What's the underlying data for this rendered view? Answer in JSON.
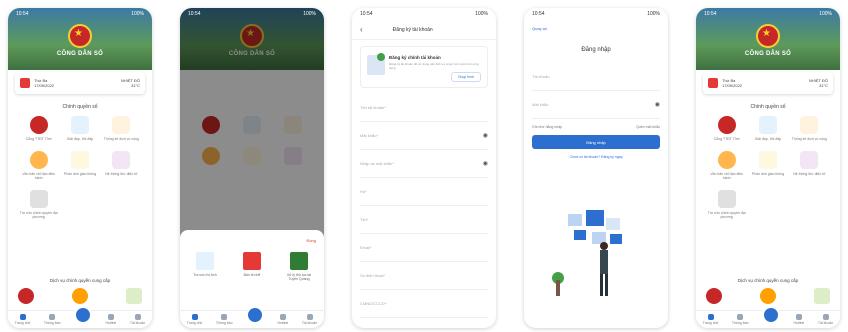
{
  "app_title": "CÔNG DÂN SỐ",
  "status": {
    "time": "10:54",
    "right": "100%"
  },
  "colors": {
    "accent": "#2d6fce",
    "red": "#e53935",
    "green": "#43a047"
  },
  "screen1": {
    "date_left_label": "Thứ Ba",
    "date_left_value": "17/05/2022",
    "date_right_label": "NHIỆT ĐỘ",
    "date_right_value": "31°C",
    "section_title": "Chính quyền số",
    "tiles": [
      {
        "label": "Cổng TTĐT Tỉnh",
        "icon": "emblem-icon",
        "color": "#c62828"
      },
      {
        "label": "Giải đáp, hỏi đáp",
        "icon": "ear-icon",
        "color": "#e3f2fd"
      },
      {
        "label": "Thống kê dịch vụ công",
        "icon": "chart-icon",
        "color": "#fff3e0"
      },
      {
        "label": "Văn bản chỉ đạo điều hành",
        "icon": "emblem-icon",
        "color": "#ffe0b2"
      },
      {
        "label": "Phản ánh giao thông",
        "icon": "hands-icon",
        "color": "#fff8e1"
      },
      {
        "label": "Hệ thống thư điện tử",
        "icon": "mail-icon",
        "color": "#f3e5f5"
      },
      {
        "label": "Tra cứu chính quyền địa phương",
        "icon": "document-icon",
        "color": "#eeeeee"
      }
    ],
    "services_title": "Dịch vụ chính quyền cung cấp",
    "nav": [
      "Trang chủ",
      "Thông báo",
      "",
      "Hotline",
      "Tài khoản"
    ]
  },
  "screen2": {
    "close_label": "Đóng",
    "items": [
      {
        "label": "Tra cứu hộ tịch",
        "color": "#e3f2fd"
      },
      {
        "label": "Bản tin thể",
        "color": "#e53935"
      },
      {
        "label": "Xử lý thủ tục tại Tuyên Quang",
        "color": "#2e7d32"
      }
    ]
  },
  "screen3": {
    "header": "Đăng ký tài khoản",
    "card_title": "Đăng ký chính tài khoản",
    "card_desc": "Đăng ký tài khoản để sử dụng các dịch vụ công trực tuyến trên ứng dụng",
    "card_button": "Chụp hình",
    "fields": [
      "Tên tài khoản*",
      "Mật khẩu*",
      "Nhập lại mật khẩu*",
      "Họ*",
      "Tên*",
      "Email*",
      "Số điện thoại*",
      "CMND/CCCD*"
    ]
  },
  "screen4": {
    "back": "Quay lại",
    "title": "Đăng nhập",
    "username_placeholder": "Tài khoản",
    "password_placeholder": "Mật khẩu",
    "remember": "Ghi nhớ đăng nhập",
    "forgot": "Quên mật khẩu",
    "login_button": "Đăng nhập",
    "register_link": "Chưa có tài khoản? Đăng ký ngay"
  }
}
